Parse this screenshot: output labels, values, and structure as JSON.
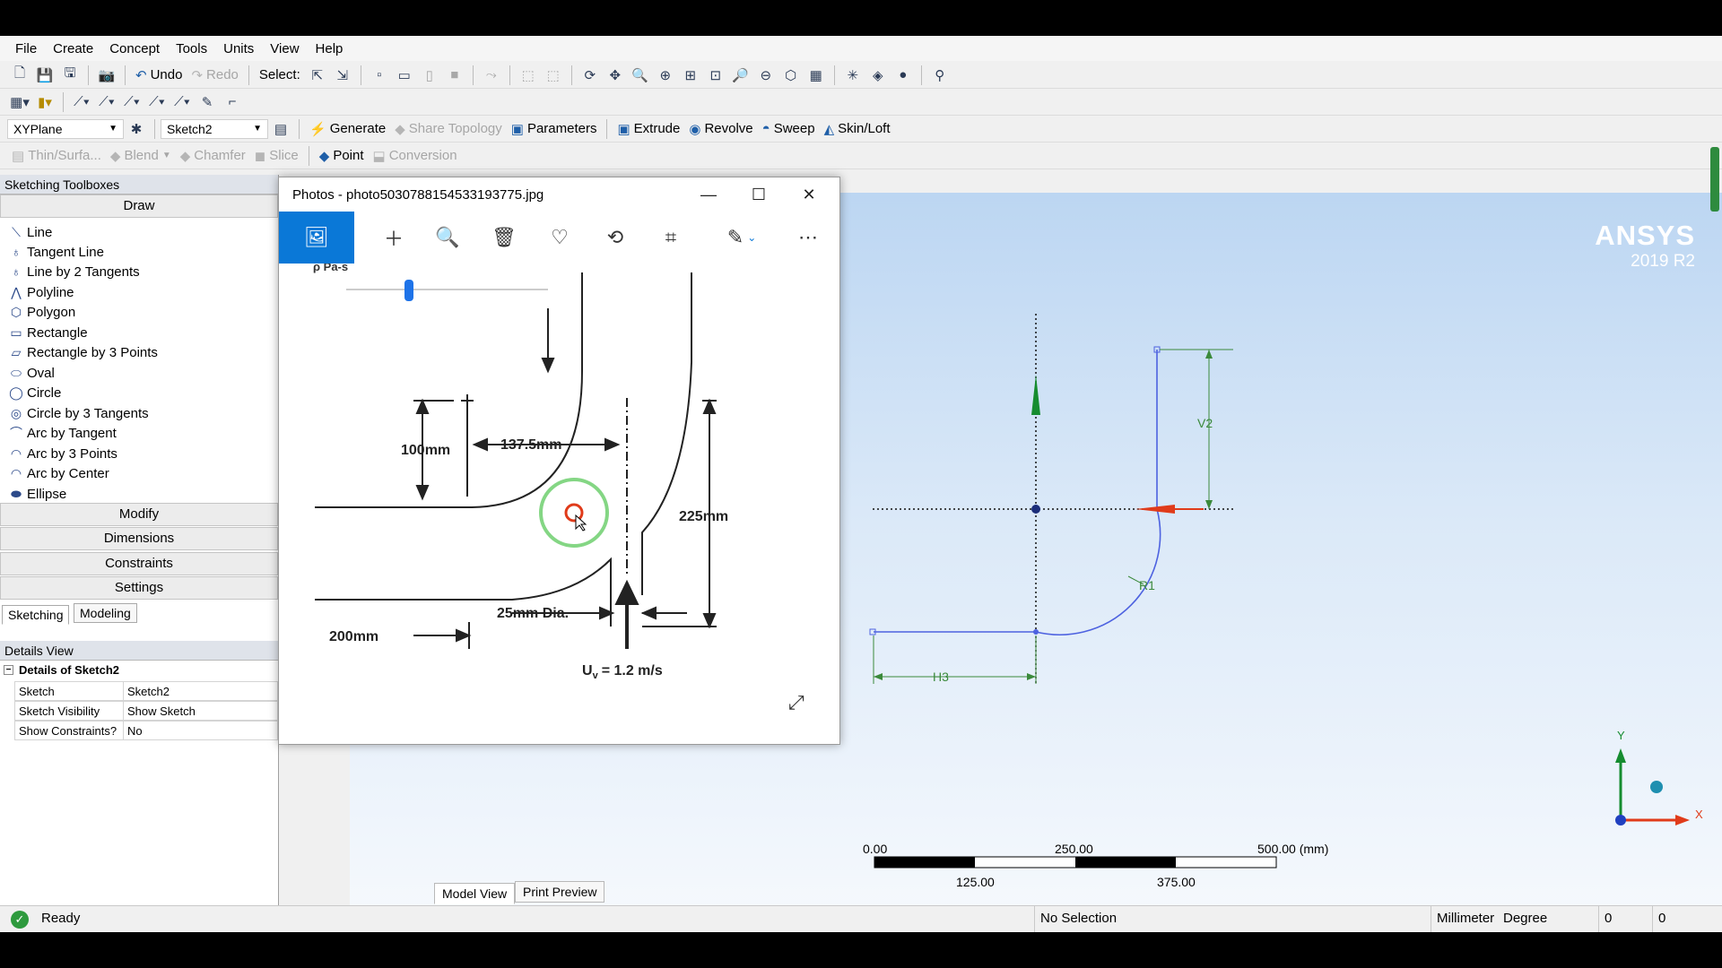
{
  "menu": [
    "File",
    "Create",
    "Concept",
    "Tools",
    "Units",
    "View",
    "Help"
  ],
  "toolbar1": {
    "undo": "Undo",
    "redo": "Redo",
    "select": "Select:"
  },
  "toolbar3": {
    "plane": "XYPlane",
    "sketch": "Sketch2",
    "generate": "Generate",
    "share_topology": "Share Topology",
    "parameters": "Parameters",
    "extrude": "Extrude",
    "revolve": "Revolve",
    "sweep": "Sweep",
    "skin_loft": "Skin/Loft"
  },
  "toolbar4": {
    "thin": "Thin/Surfa...",
    "blend": "Blend",
    "chamfer": "Chamfer",
    "slice": "Slice",
    "point": "Point",
    "conversion": "Conversion"
  },
  "sketching": {
    "title": "Sketching Toolboxes",
    "draw": "Draw",
    "tools": [
      "Line",
      "Tangent Line",
      "Line by 2 Tangents",
      "Polyline",
      "Polygon",
      "Rectangle",
      "Rectangle by 3 Points",
      "Oval",
      "Circle",
      "Circle by 3 Tangents",
      "Arc by Tangent",
      "Arc by 3 Points",
      "Arc by Center",
      "Ellipse"
    ],
    "sections": [
      "Modify",
      "Dimensions",
      "Constraints",
      "Settings"
    ],
    "tabs": [
      "Sketching",
      "Modeling"
    ]
  },
  "details": {
    "title": "Details View",
    "group": "Details of Sketch2",
    "rows": [
      {
        "k": "Sketch",
        "v": "Sketch2"
      },
      {
        "k": "Sketch Visibility",
        "v": "Show Sketch"
      },
      {
        "k": "Show Constraints?",
        "v": "No"
      }
    ]
  },
  "photos": {
    "title": "Photos - photo5030788154533193775.jpg",
    "image": {
      "partial_top": "ρ   Pa-s",
      "dim_100": "100mm",
      "dim_137": "137.5mm",
      "dim_225": "225mm",
      "dim_25": "25mm Dia.",
      "dim_200": "200mm",
      "velocity": "U",
      "velocity_sub": "v",
      "velocity_val": "= 1.2 m/s"
    }
  },
  "viewport": {
    "brand": "ANSYS",
    "version": "2019 R2",
    "labels": {
      "v2": "V2",
      "r1": "R1",
      "h3": "H3"
    },
    "scale": {
      "top": [
        "0.00",
        "250.00",
        "500.00 (mm)"
      ],
      "bottom": [
        "125.00",
        "375.00"
      ]
    },
    "axes": {
      "y": "Y",
      "x": "X"
    }
  },
  "bottom_tabs": [
    "Model View",
    "Print Preview"
  ],
  "status": {
    "ready": "Ready",
    "selection": "No Selection",
    "unit1": "Millimeter",
    "unit2": "Degree",
    "v1": "0",
    "v2": "0"
  }
}
